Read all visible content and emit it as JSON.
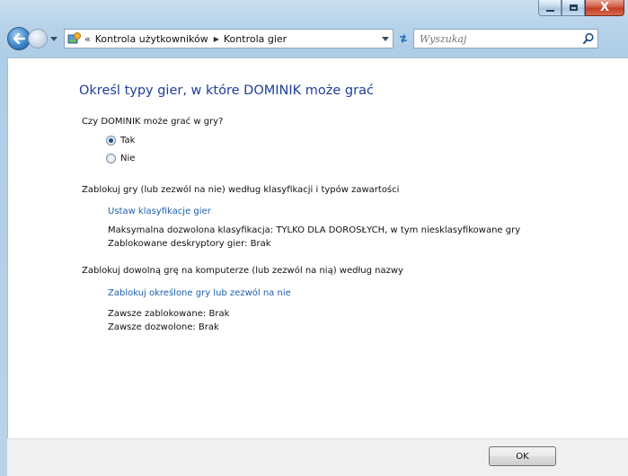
{
  "window": {
    "caption": {
      "minimize": "–",
      "maximize": "□",
      "close": "X"
    }
  },
  "navbar": {
    "breadcrumb_prefix": "«",
    "breadcrumbs": [
      "Kontrola użytkowników",
      "Kontrola gier"
    ],
    "search_placeholder": "Wyszukaj"
  },
  "main": {
    "title": "Określ typy gier, w które DOMINIK może grać",
    "question": "Czy DOMINIK może grać w gry?",
    "radio_options": [
      {
        "label": "Tak",
        "checked": true
      },
      {
        "label": "Nie",
        "checked": false
      }
    ],
    "section1": {
      "heading": "Zablokuj gry (lub zezwól na nie) według klasyfikacji i typów zawartości",
      "link": "Ustaw klasyfikacje gier",
      "max_rating": "Maksymalna dozwolona klasyfikacja:  TYLKO DLA DOROSŁYCH, w tym niesklasyfikowane gry",
      "blocked_descriptors": "Zablokowane deskryptory gier:  Brak"
    },
    "section2": {
      "heading": "Zablokuj dowolną grę na komputerze (lub zezwól na nią) według nazwy",
      "link": "Zablokuj określone gry lub zezwól na nie",
      "always_blocked": "Zawsze zablokowane:  Brak",
      "always_allowed": "Zawsze dozwolone:  Brak"
    }
  },
  "footer": {
    "ok_label": "OK"
  },
  "colors": {
    "title": "#1e3e9a",
    "link": "#1a5fb0",
    "frame": "#b7d3ea"
  }
}
